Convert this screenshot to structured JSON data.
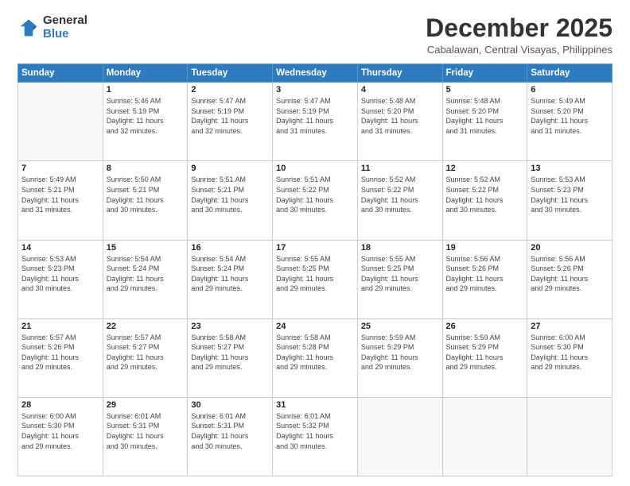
{
  "logo": {
    "general": "General",
    "blue": "Blue"
  },
  "header": {
    "month": "December 2025",
    "location": "Cabalawan, Central Visayas, Philippines"
  },
  "weekdays": [
    "Sunday",
    "Monday",
    "Tuesday",
    "Wednesday",
    "Thursday",
    "Friday",
    "Saturday"
  ],
  "weeks": [
    [
      {
        "day": "",
        "info": ""
      },
      {
        "day": "1",
        "info": "Sunrise: 5:46 AM\nSunset: 5:19 PM\nDaylight: 11 hours\nand 32 minutes."
      },
      {
        "day": "2",
        "info": "Sunrise: 5:47 AM\nSunset: 5:19 PM\nDaylight: 11 hours\nand 32 minutes."
      },
      {
        "day": "3",
        "info": "Sunrise: 5:47 AM\nSunset: 5:19 PM\nDaylight: 11 hours\nand 31 minutes."
      },
      {
        "day": "4",
        "info": "Sunrise: 5:48 AM\nSunset: 5:20 PM\nDaylight: 11 hours\nand 31 minutes."
      },
      {
        "day": "5",
        "info": "Sunrise: 5:48 AM\nSunset: 5:20 PM\nDaylight: 11 hours\nand 31 minutes."
      },
      {
        "day": "6",
        "info": "Sunrise: 5:49 AM\nSunset: 5:20 PM\nDaylight: 11 hours\nand 31 minutes."
      }
    ],
    [
      {
        "day": "7",
        "info": "Sunrise: 5:49 AM\nSunset: 5:21 PM\nDaylight: 11 hours\nand 31 minutes."
      },
      {
        "day": "8",
        "info": "Sunrise: 5:50 AM\nSunset: 5:21 PM\nDaylight: 11 hours\nand 30 minutes."
      },
      {
        "day": "9",
        "info": "Sunrise: 5:51 AM\nSunset: 5:21 PM\nDaylight: 11 hours\nand 30 minutes."
      },
      {
        "day": "10",
        "info": "Sunrise: 5:51 AM\nSunset: 5:22 PM\nDaylight: 11 hours\nand 30 minutes."
      },
      {
        "day": "11",
        "info": "Sunrise: 5:52 AM\nSunset: 5:22 PM\nDaylight: 11 hours\nand 30 minutes."
      },
      {
        "day": "12",
        "info": "Sunrise: 5:52 AM\nSunset: 5:22 PM\nDaylight: 11 hours\nand 30 minutes."
      },
      {
        "day": "13",
        "info": "Sunrise: 5:53 AM\nSunset: 5:23 PM\nDaylight: 11 hours\nand 30 minutes."
      }
    ],
    [
      {
        "day": "14",
        "info": "Sunrise: 5:53 AM\nSunset: 5:23 PM\nDaylight: 11 hours\nand 30 minutes."
      },
      {
        "day": "15",
        "info": "Sunrise: 5:54 AM\nSunset: 5:24 PM\nDaylight: 11 hours\nand 29 minutes."
      },
      {
        "day": "16",
        "info": "Sunrise: 5:54 AM\nSunset: 5:24 PM\nDaylight: 11 hours\nand 29 minutes."
      },
      {
        "day": "17",
        "info": "Sunrise: 5:55 AM\nSunset: 5:25 PM\nDaylight: 11 hours\nand 29 minutes."
      },
      {
        "day": "18",
        "info": "Sunrise: 5:55 AM\nSunset: 5:25 PM\nDaylight: 11 hours\nand 29 minutes."
      },
      {
        "day": "19",
        "info": "Sunrise: 5:56 AM\nSunset: 5:26 PM\nDaylight: 11 hours\nand 29 minutes."
      },
      {
        "day": "20",
        "info": "Sunrise: 5:56 AM\nSunset: 5:26 PM\nDaylight: 11 hours\nand 29 minutes."
      }
    ],
    [
      {
        "day": "21",
        "info": "Sunrise: 5:57 AM\nSunset: 5:26 PM\nDaylight: 11 hours\nand 29 minutes."
      },
      {
        "day": "22",
        "info": "Sunrise: 5:57 AM\nSunset: 5:27 PM\nDaylight: 11 hours\nand 29 minutes."
      },
      {
        "day": "23",
        "info": "Sunrise: 5:58 AM\nSunset: 5:27 PM\nDaylight: 11 hours\nand 29 minutes."
      },
      {
        "day": "24",
        "info": "Sunrise: 5:58 AM\nSunset: 5:28 PM\nDaylight: 11 hours\nand 29 minutes."
      },
      {
        "day": "25",
        "info": "Sunrise: 5:59 AM\nSunset: 5:29 PM\nDaylight: 11 hours\nand 29 minutes."
      },
      {
        "day": "26",
        "info": "Sunrise: 5:59 AM\nSunset: 5:29 PM\nDaylight: 11 hours\nand 29 minutes."
      },
      {
        "day": "27",
        "info": "Sunrise: 6:00 AM\nSunset: 5:30 PM\nDaylight: 11 hours\nand 29 minutes."
      }
    ],
    [
      {
        "day": "28",
        "info": "Sunrise: 6:00 AM\nSunset: 5:30 PM\nDaylight: 11 hours\nand 29 minutes."
      },
      {
        "day": "29",
        "info": "Sunrise: 6:01 AM\nSunset: 5:31 PM\nDaylight: 11 hours\nand 30 minutes."
      },
      {
        "day": "30",
        "info": "Sunrise: 6:01 AM\nSunset: 5:31 PM\nDaylight: 11 hours\nand 30 minutes."
      },
      {
        "day": "31",
        "info": "Sunrise: 6:01 AM\nSunset: 5:32 PM\nDaylight: 11 hours\nand 30 minutes."
      },
      {
        "day": "",
        "info": ""
      },
      {
        "day": "",
        "info": ""
      },
      {
        "day": "",
        "info": ""
      }
    ]
  ]
}
